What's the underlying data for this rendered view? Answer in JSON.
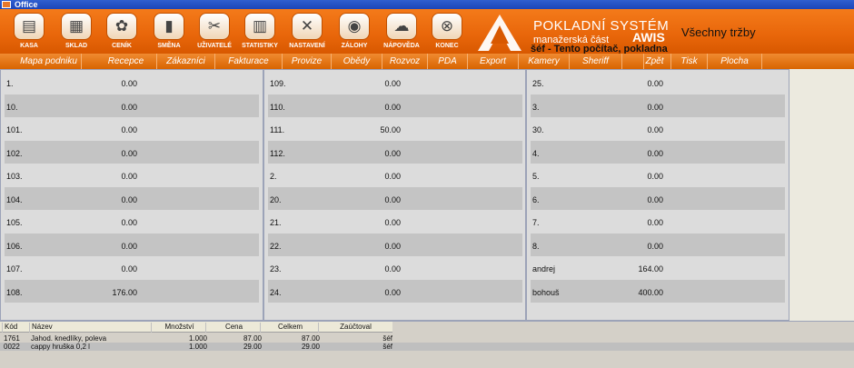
{
  "window": {
    "title": "Office"
  },
  "toolbar": {
    "buttons": [
      {
        "label": "KASA",
        "icon": "cash-register-icon",
        "glyph": "▤"
      },
      {
        "label": "SKLAD",
        "icon": "warehouse-icon",
        "glyph": "▦"
      },
      {
        "label": "CENÍK",
        "icon": "pricelist-icon",
        "glyph": "✿"
      },
      {
        "label": "SMĚNA",
        "icon": "shift-icon",
        "glyph": "▮"
      },
      {
        "label": "UŽIVATELÉ",
        "icon": "users-icon",
        "glyph": "✂"
      },
      {
        "label": "STATISTIKY",
        "icon": "statistics-icon",
        "glyph": "▥"
      },
      {
        "label": "NASTAVENÍ",
        "icon": "settings-icon",
        "glyph": "✕"
      },
      {
        "label": "ZÁLOHY",
        "icon": "backup-icon",
        "glyph": "◉"
      },
      {
        "label": "NÁPOVĚDA",
        "icon": "help-icon",
        "glyph": "☁"
      },
      {
        "label": "KONEC",
        "icon": "exit-icon",
        "glyph": "⊗"
      }
    ]
  },
  "brand": {
    "title": "POKLADNÍ SYSTÉM",
    "subtitle": "manažerská část",
    "product": "AWIS",
    "info": "šéf  -  Tento počítač, pokladna",
    "summary": "Všechny tržby",
    "accent": "#e8660a"
  },
  "menu": [
    "Mapa podniku",
    "Recepce",
    "Zákazníci",
    "Fakturace",
    "Provize",
    "Obědy",
    "Rozvoz",
    "PDA",
    "Export",
    "Kamery",
    "Sheriff",
    "",
    "Zpět",
    "Tisk",
    "Plocha"
  ],
  "panels": [
    {
      "rows": [
        {
          "label": "1.",
          "value": "0.00"
        },
        {
          "label": "10.",
          "value": "0.00"
        },
        {
          "label": "101.",
          "value": "0.00"
        },
        {
          "label": "102.",
          "value": "0.00"
        },
        {
          "label": "103.",
          "value": "0.00"
        },
        {
          "label": "104.",
          "value": "0.00"
        },
        {
          "label": "105.",
          "value": "0.00"
        },
        {
          "label": "106.",
          "value": "0.00"
        },
        {
          "label": "107.",
          "value": "0.00"
        },
        {
          "label": "108.",
          "value": "176.00"
        }
      ]
    },
    {
      "rows": [
        {
          "label": "109.",
          "value": "0.00"
        },
        {
          "label": "110.",
          "value": "0.00"
        },
        {
          "label": "111.",
          "value": "50.00"
        },
        {
          "label": "112.",
          "value": "0.00"
        },
        {
          "label": "2.",
          "value": "0.00"
        },
        {
          "label": "20.",
          "value": "0.00"
        },
        {
          "label": "21.",
          "value": "0.00"
        },
        {
          "label": "22.",
          "value": "0.00"
        },
        {
          "label": "23.",
          "value": "0.00"
        },
        {
          "label": "24.",
          "value": "0.00"
        }
      ]
    },
    {
      "rows": [
        {
          "label": "25.",
          "value": "0.00"
        },
        {
          "label": "3.",
          "value": "0.00"
        },
        {
          "label": "30.",
          "value": "0.00"
        },
        {
          "label": "4.",
          "value": "0.00"
        },
        {
          "label": "5.",
          "value": "0.00"
        },
        {
          "label": "6.",
          "value": "0.00"
        },
        {
          "label": "7.",
          "value": "0.00"
        },
        {
          "label": "8.",
          "value": "0.00"
        },
        {
          "label": "andrej",
          "value": "164.00"
        },
        {
          "label": "bohouš",
          "value": "400.00"
        }
      ]
    }
  ],
  "items_table": {
    "columns": [
      "Kód",
      "Název",
      "Množství",
      "Cena",
      "Celkem",
      "Zaúčtoval"
    ],
    "rows": [
      [
        "1761",
        "Jahod. knedlíky, poleva",
        "1.000",
        "87.00",
        "87.00",
        "šéf"
      ],
      [
        "0022",
        "cappy hruška 0,2 l",
        "1.000",
        "29.00",
        "29.00",
        "šéf"
      ]
    ]
  }
}
